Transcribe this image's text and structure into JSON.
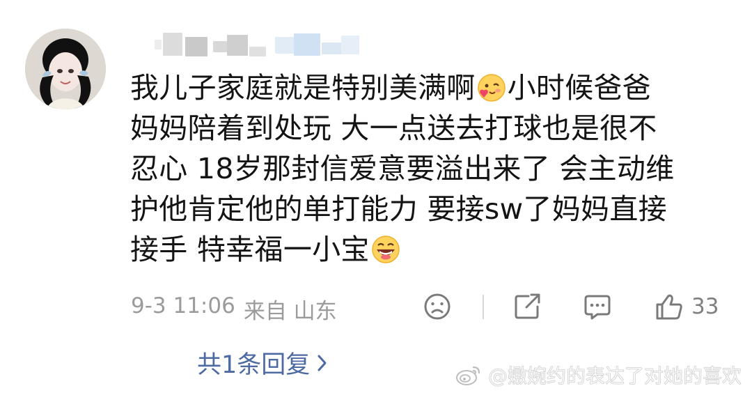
{
  "comment": {
    "lines": [
      [
        "我儿子家庭就是特别美满啊",
        "emoji:heart-face",
        " 小时候爸爸"
      ],
      [
        "妈妈陪着到处玩 大一点送去打球也是很不"
      ],
      [
        "忍心 18岁那封信爱意要溢出来了 会主动维"
      ],
      [
        "护他肯定他的单打能力 要接sw了妈妈直接"
      ],
      [
        "接手 特幸福一小宝",
        "emoji:laugh-face"
      ]
    ]
  },
  "meta": {
    "time": "9-3 11:06",
    "source": "来自 山东"
  },
  "actions": {
    "dislike_icon": "frown-face-icon",
    "share_icon": "share-icon",
    "comment_icon": "comment-icon",
    "like_icon": "thumbs-up-icon",
    "like_count": "33"
  },
  "reply": {
    "label": "共1条回复"
  },
  "watermark": {
    "text": "@嫐婉约的表达了对她的喜欢"
  },
  "colors": {
    "text": "#141414",
    "meta": "#9b9b9b",
    "link": "#4d6aa2",
    "icon": "#808080"
  }
}
